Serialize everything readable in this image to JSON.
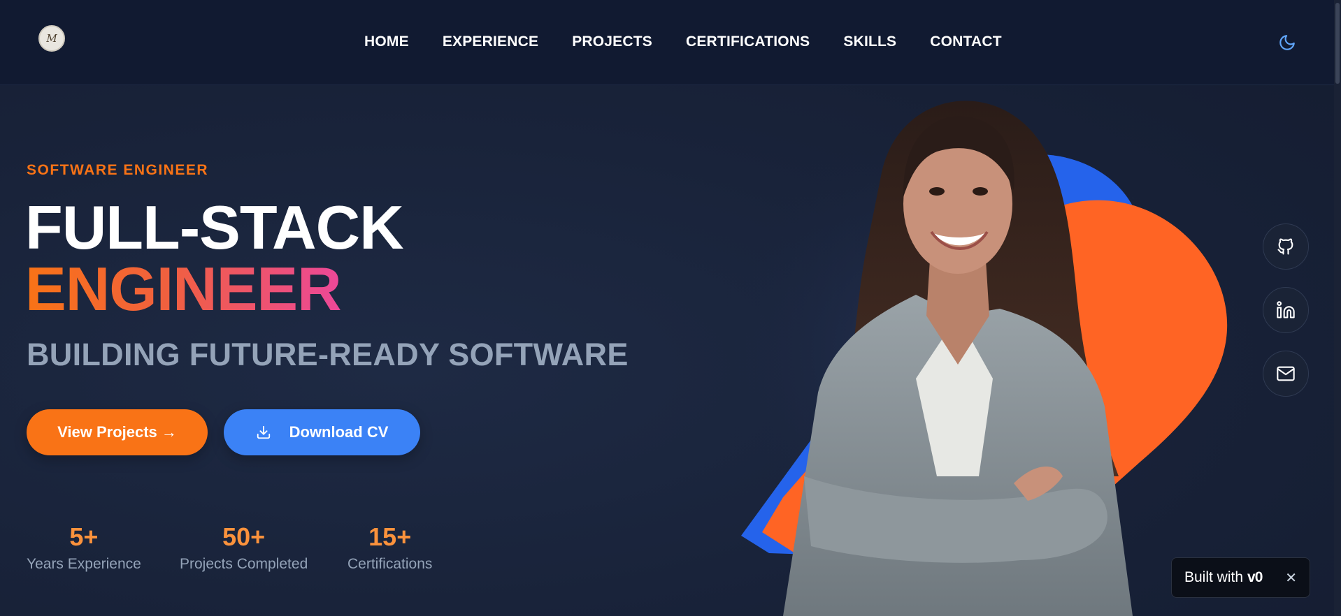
{
  "nav": {
    "logo_text": "M",
    "items": [
      "HOME",
      "EXPERIENCE",
      "PROJECTS",
      "CERTIFICATIONS",
      "SKILLS",
      "CONTACT"
    ],
    "theme_icon": "moon-icon"
  },
  "hero": {
    "eyebrow": "SOFTWARE ENGINEER",
    "headline_line1": "FULL-STACK",
    "headline_line2": "ENGINEER",
    "tagline": "BUILDING FUTURE-READY SOFTWARE",
    "primary_button": "View Projects →",
    "secondary_button": "Download CV",
    "download_icon": "download-icon",
    "stats": [
      {
        "value": "5+",
        "label": "Years Experience"
      },
      {
        "value": "50+",
        "label": "Projects Completed"
      },
      {
        "value": "15+",
        "label": "Certifications"
      }
    ]
  },
  "social": {
    "icons": [
      "github-icon",
      "linkedin-icon",
      "mail-icon"
    ]
  },
  "badge": {
    "text": "Built with",
    "mark": "v0",
    "close_icon": "close-icon",
    "close_glyph": "✕"
  },
  "colors": {
    "accent_orange": "#f97316",
    "accent_blue": "#3b82f6",
    "accent_pink": "#ec4899",
    "background": "#19233a"
  }
}
